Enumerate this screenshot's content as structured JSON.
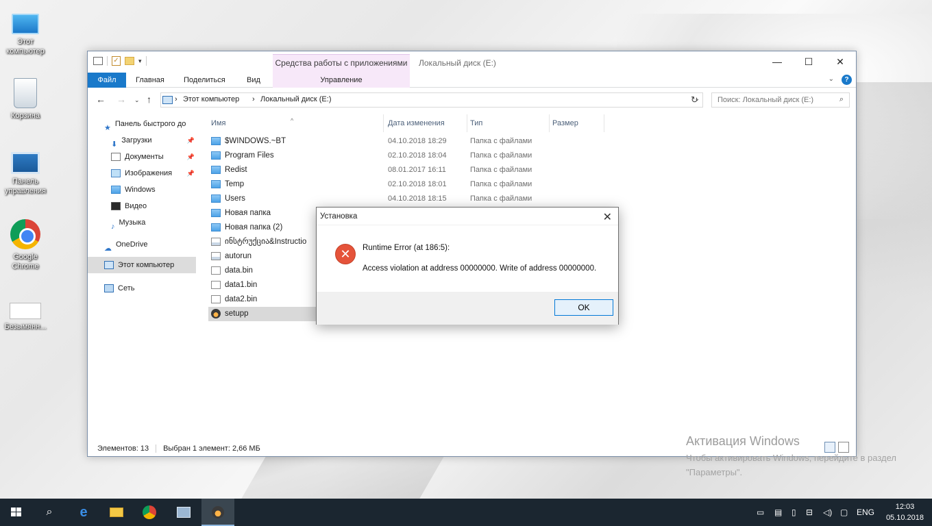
{
  "desktop": {
    "icons": [
      {
        "label": "Этот компьютер"
      },
      {
        "label": "Корзина"
      },
      {
        "label": "Панель управления"
      },
      {
        "label": "Google Chrome"
      },
      {
        "label": "Безымянн..."
      }
    ]
  },
  "explorer": {
    "tools_group": "Средства работы с приложениями",
    "title": "Локальный диск (E:)",
    "ribbon_tabs": [
      "Файл",
      "Главная",
      "Поделиться",
      "Вид"
    ],
    "manage_tab": "Управление",
    "address": {
      "root": "Этот компьютер",
      "current": "Локальный диск (E:)"
    },
    "search_placeholder": "Поиск: Локальный диск (E:)",
    "nav": [
      {
        "label": "Панель быстрого до"
      },
      {
        "label": "Загрузки"
      },
      {
        "label": "Документы"
      },
      {
        "label": "Изображения"
      },
      {
        "label": "Windows"
      },
      {
        "label": "Видео"
      },
      {
        "label": "Музыка"
      },
      {
        "label": "OneDrive"
      },
      {
        "label": "Этот компьютер"
      },
      {
        "label": "Сеть"
      }
    ],
    "columns": [
      "Имя",
      "Дата изменения",
      "Тип",
      "Размер"
    ],
    "files": [
      {
        "name": "$WINDOWS.~BT",
        "date": "04.10.2018 18:29",
        "type": "Папка с файлами",
        "icon": "folder"
      },
      {
        "name": "Program Files",
        "date": "02.10.2018 18:04",
        "type": "Папка с файлами",
        "icon": "folder"
      },
      {
        "name": "Redist",
        "date": "08.01.2017 16:11",
        "type": "Папка с файлами",
        "icon": "folder"
      },
      {
        "name": "Temp",
        "date": "02.10.2018 18:01",
        "type": "Папка с файлами",
        "icon": "folder"
      },
      {
        "name": "Users",
        "date": "04.10.2018 18:15",
        "type": "Папка с файлами",
        "icon": "folder"
      },
      {
        "name": "Новая папка",
        "date": "",
        "type": "",
        "icon": "folder"
      },
      {
        "name": "Новая папка (2)",
        "date": "",
        "type": "",
        "icon": "folder"
      },
      {
        "name": "ინსტრუქცია&Instructio",
        "date": "",
        "type": "",
        "icon": "doc"
      },
      {
        "name": "autorun",
        "date": "",
        "type": "",
        "icon": "cfg"
      },
      {
        "name": "data.bin",
        "date": "",
        "type": "",
        "icon": "doc"
      },
      {
        "name": "data1.bin",
        "date": "",
        "type": "",
        "icon": "doc"
      },
      {
        "name": "data2.bin",
        "date": "",
        "type": "",
        "icon": "doc"
      },
      {
        "name": "setupp",
        "date": "",
        "type": "",
        "icon": "app"
      }
    ],
    "status": {
      "count": "Элементов: 13",
      "selected": "Выбран 1 элемент: 2,66 МБ"
    }
  },
  "dialog": {
    "title": "Установка",
    "line1": "Runtime Error (at 186:5):",
    "line2": "Access violation at address 00000000. Write of address 00000000.",
    "ok": "OK"
  },
  "activation": {
    "title": "Активация Windows",
    "text": "Чтобы активировать Windows, перейдите в раздел \"Параметры\"."
  },
  "taskbar": {
    "lang": "ENG",
    "time": "12:03",
    "date": "05.10.2018"
  },
  "colors": {
    "accent": "#1979ca",
    "taskbar": "#1b2630",
    "error": "#e5533a"
  }
}
